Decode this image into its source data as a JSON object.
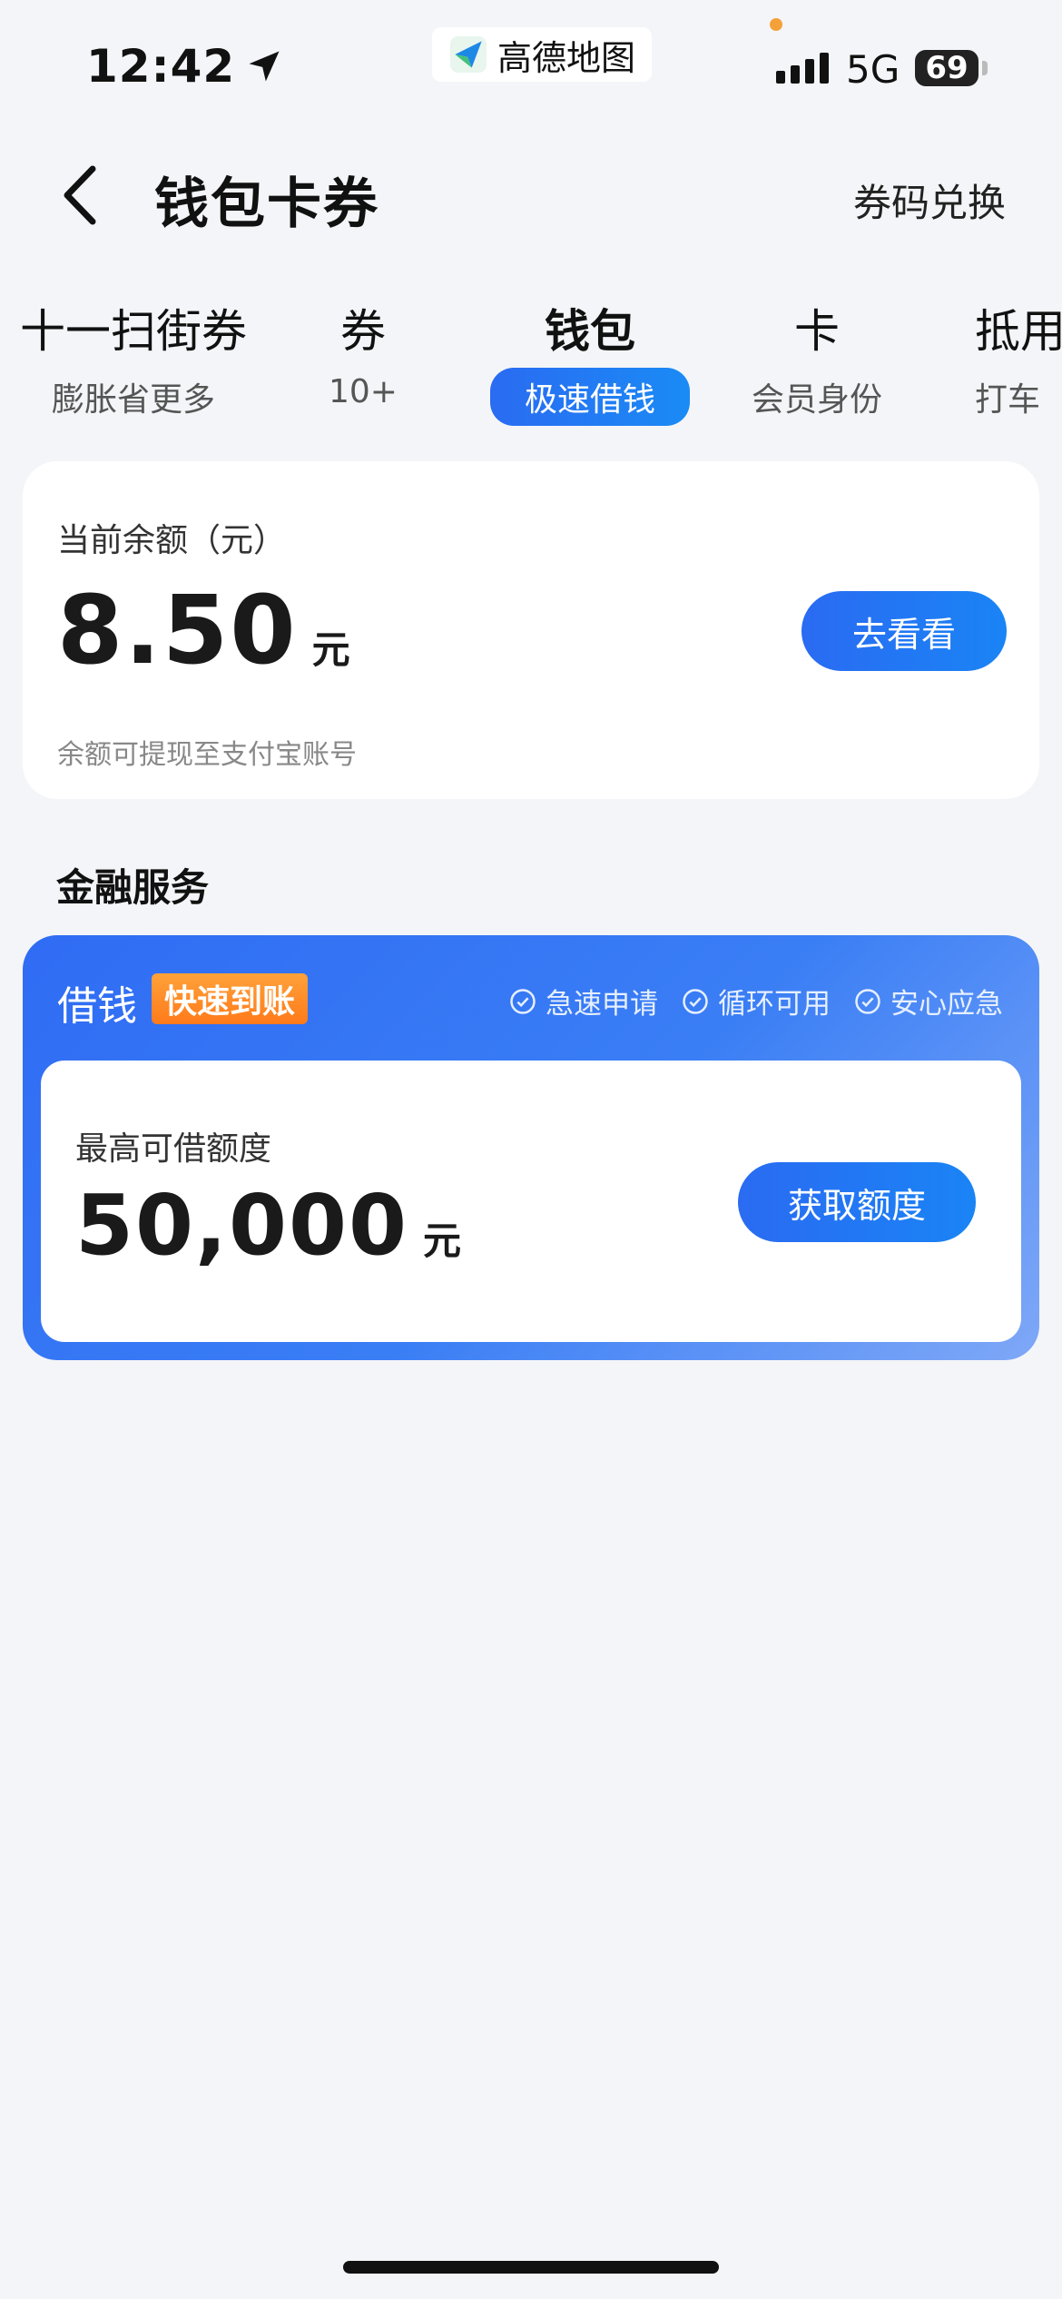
{
  "status_bar": {
    "time": "12:42",
    "app_name": "高德地图",
    "network": "5G",
    "battery": "69",
    "signal_bars": 4
  },
  "header": {
    "title": "钱包卡券",
    "redeem_label": "券码兑换"
  },
  "tabs": [
    {
      "label": "十一扫街券",
      "sub": "膨胀省更多"
    },
    {
      "label": "券",
      "sub": "10+"
    },
    {
      "label": "钱包",
      "sub": "极速借钱",
      "active": true
    },
    {
      "label": "卡",
      "sub": "会员身份"
    },
    {
      "label": "抵用",
      "sub": "打车"
    }
  ],
  "balance": {
    "label": "当前余额（元）",
    "amount": "8.50",
    "unit": "元",
    "button": "去看看",
    "note": "余额可提现至支付宝账号"
  },
  "finance": {
    "section_title": "金融服务",
    "loan_title": "借钱",
    "fast_badge": "快速到账",
    "features": [
      "急速申请",
      "循环可用",
      "安心应急"
    ],
    "limit_label": "最高可借额度",
    "limit_amount": "50,000",
    "unit": "元",
    "button": "获取额度"
  },
  "colors": {
    "accent": "#2a6bf2",
    "badge": "#ff8a24",
    "background": "#f4f5f8"
  }
}
